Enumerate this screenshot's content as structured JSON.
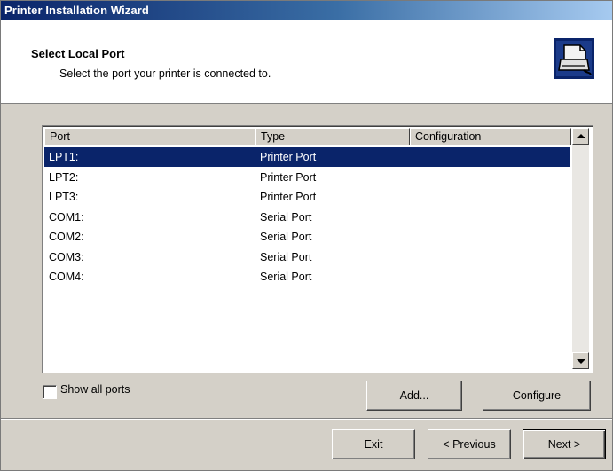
{
  "window": {
    "title": "Printer Installation Wizard"
  },
  "header": {
    "title": "Select Local Port",
    "subtitle": "Select the port your printer is connected to.",
    "icon": "printer-icon"
  },
  "ports_list": {
    "columns": [
      "Port",
      "Type",
      "Configuration"
    ],
    "rows": [
      {
        "port": "LPT1:",
        "type": "Printer Port",
        "configuration": "",
        "selected": true
      },
      {
        "port": "LPT2:",
        "type": "Printer Port",
        "configuration": ""
      },
      {
        "port": "LPT3:",
        "type": "Printer Port",
        "configuration": ""
      },
      {
        "port": "COM1:",
        "type": "Serial Port",
        "configuration": ""
      },
      {
        "port": "COM2:",
        "type": "Serial Port",
        "configuration": ""
      },
      {
        "port": "COM3:",
        "type": "Serial Port",
        "configuration": ""
      },
      {
        "port": "COM4:",
        "type": "Serial Port",
        "configuration": ""
      }
    ]
  },
  "options": {
    "show_all_ports_label": "Show all ports",
    "show_all_ports_checked": false,
    "add_label": "Add...",
    "configure_label": "Configure"
  },
  "footer": {
    "exit_label": "Exit",
    "previous_label": "< Previous",
    "next_label": "Next >"
  },
  "colors": {
    "selection": "#0a246a",
    "face": "#d4d0c8",
    "title_start": "#0a246a",
    "title_end": "#a6caf0"
  }
}
